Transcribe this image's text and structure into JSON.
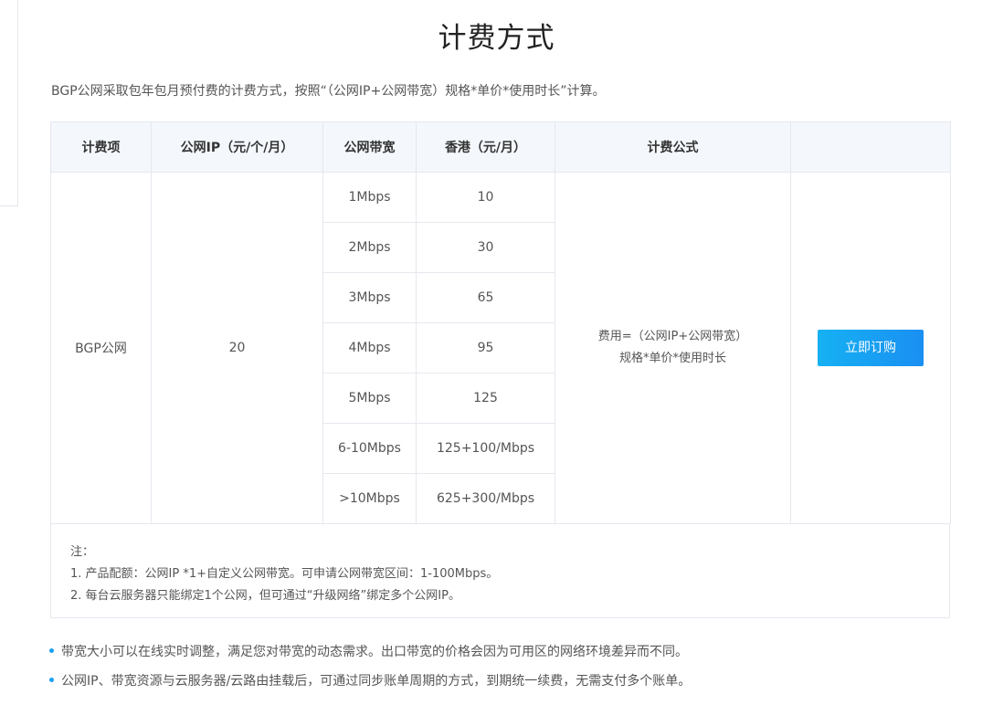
{
  "page": {
    "title": "计费方式",
    "intro": "BGP公网采取包年包月预付费的计费方式，按照“（公网IP+公网带宽）规格*单价*使用时长”计算。"
  },
  "table": {
    "headers": [
      "计费项",
      "公网IP（元/个/月）",
      "公网带宽",
      "香港（元/月）",
      "计费公式",
      ""
    ],
    "item": "BGP公网",
    "ip_price": "20",
    "rows": [
      {
        "bandwidth": "1Mbps",
        "price": "10"
      },
      {
        "bandwidth": "2Mbps",
        "price": "30"
      },
      {
        "bandwidth": "3Mbps",
        "price": "65"
      },
      {
        "bandwidth": "4Mbps",
        "price": "95"
      },
      {
        "bandwidth": "5Mbps",
        "price": "125"
      },
      {
        "bandwidth": "6-10Mbps",
        "price": "125+100/Mbps"
      },
      {
        "bandwidth": ">10Mbps",
        "price": "625+300/Mbps"
      }
    ],
    "formula_line1": "费用=（公网IP+公网带宽）",
    "formula_line2": "规格*单价*使用时长",
    "order_button": "立即订购"
  },
  "notes": {
    "label": "注：",
    "items": [
      "1. 产品配额：公网IP *1+自定义公网带宽。可申请公网带宽区间：1-100Mbps。",
      "2. 每台云服务器只能绑定1个公网，但可通过“升级网络”绑定多个公网IP。"
    ]
  },
  "bullets": [
    "带宽大小可以在线实时调整，满足您对带宽的动态需求。出口带宽的价格会因为可用区的网络环境差异而不同。",
    "公网IP、带宽资源与云服务器/云路由挂载后，可通过同步账单周期的方式，到期统一续费，无需支付多个账单。"
  ]
}
